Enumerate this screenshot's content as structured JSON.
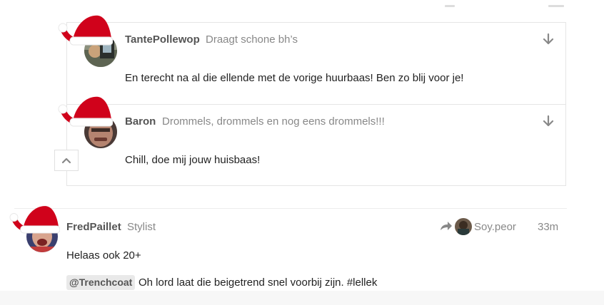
{
  "thread": {
    "replies": [
      {
        "username": "TantePollewop",
        "user_title": "Draagt schone bh’s",
        "text": "En terecht na al die ellende met de vorige huurbaas! Ben zo blij voor je!"
      },
      {
        "username": "Baron",
        "user_title": "Drommels, drommels en nog eens drommels!!!",
        "text": "Chill, doe mij jouw huisbaas!"
      }
    ]
  },
  "post": {
    "username": "FredPaillet",
    "user_title": "Stylist",
    "reply_to_user": "Soy.peor",
    "time": "33m",
    "paragraph1": "Helaas ook 20+",
    "mention": "@Trenchcoat",
    "paragraph2": "Oh lord laat die beigetrend snel voorbij zijn. #lellek"
  },
  "icons": {
    "reply_expand": "arrow-down-icon",
    "collapse": "chevron-up-icon",
    "reply_to": "share-arrow-icon",
    "hat": "santa-hat-icon"
  },
  "colors": {
    "hat_red": "#d0021b",
    "username": "#555555",
    "user_title": "#888888",
    "border": "#e5e5e5"
  }
}
